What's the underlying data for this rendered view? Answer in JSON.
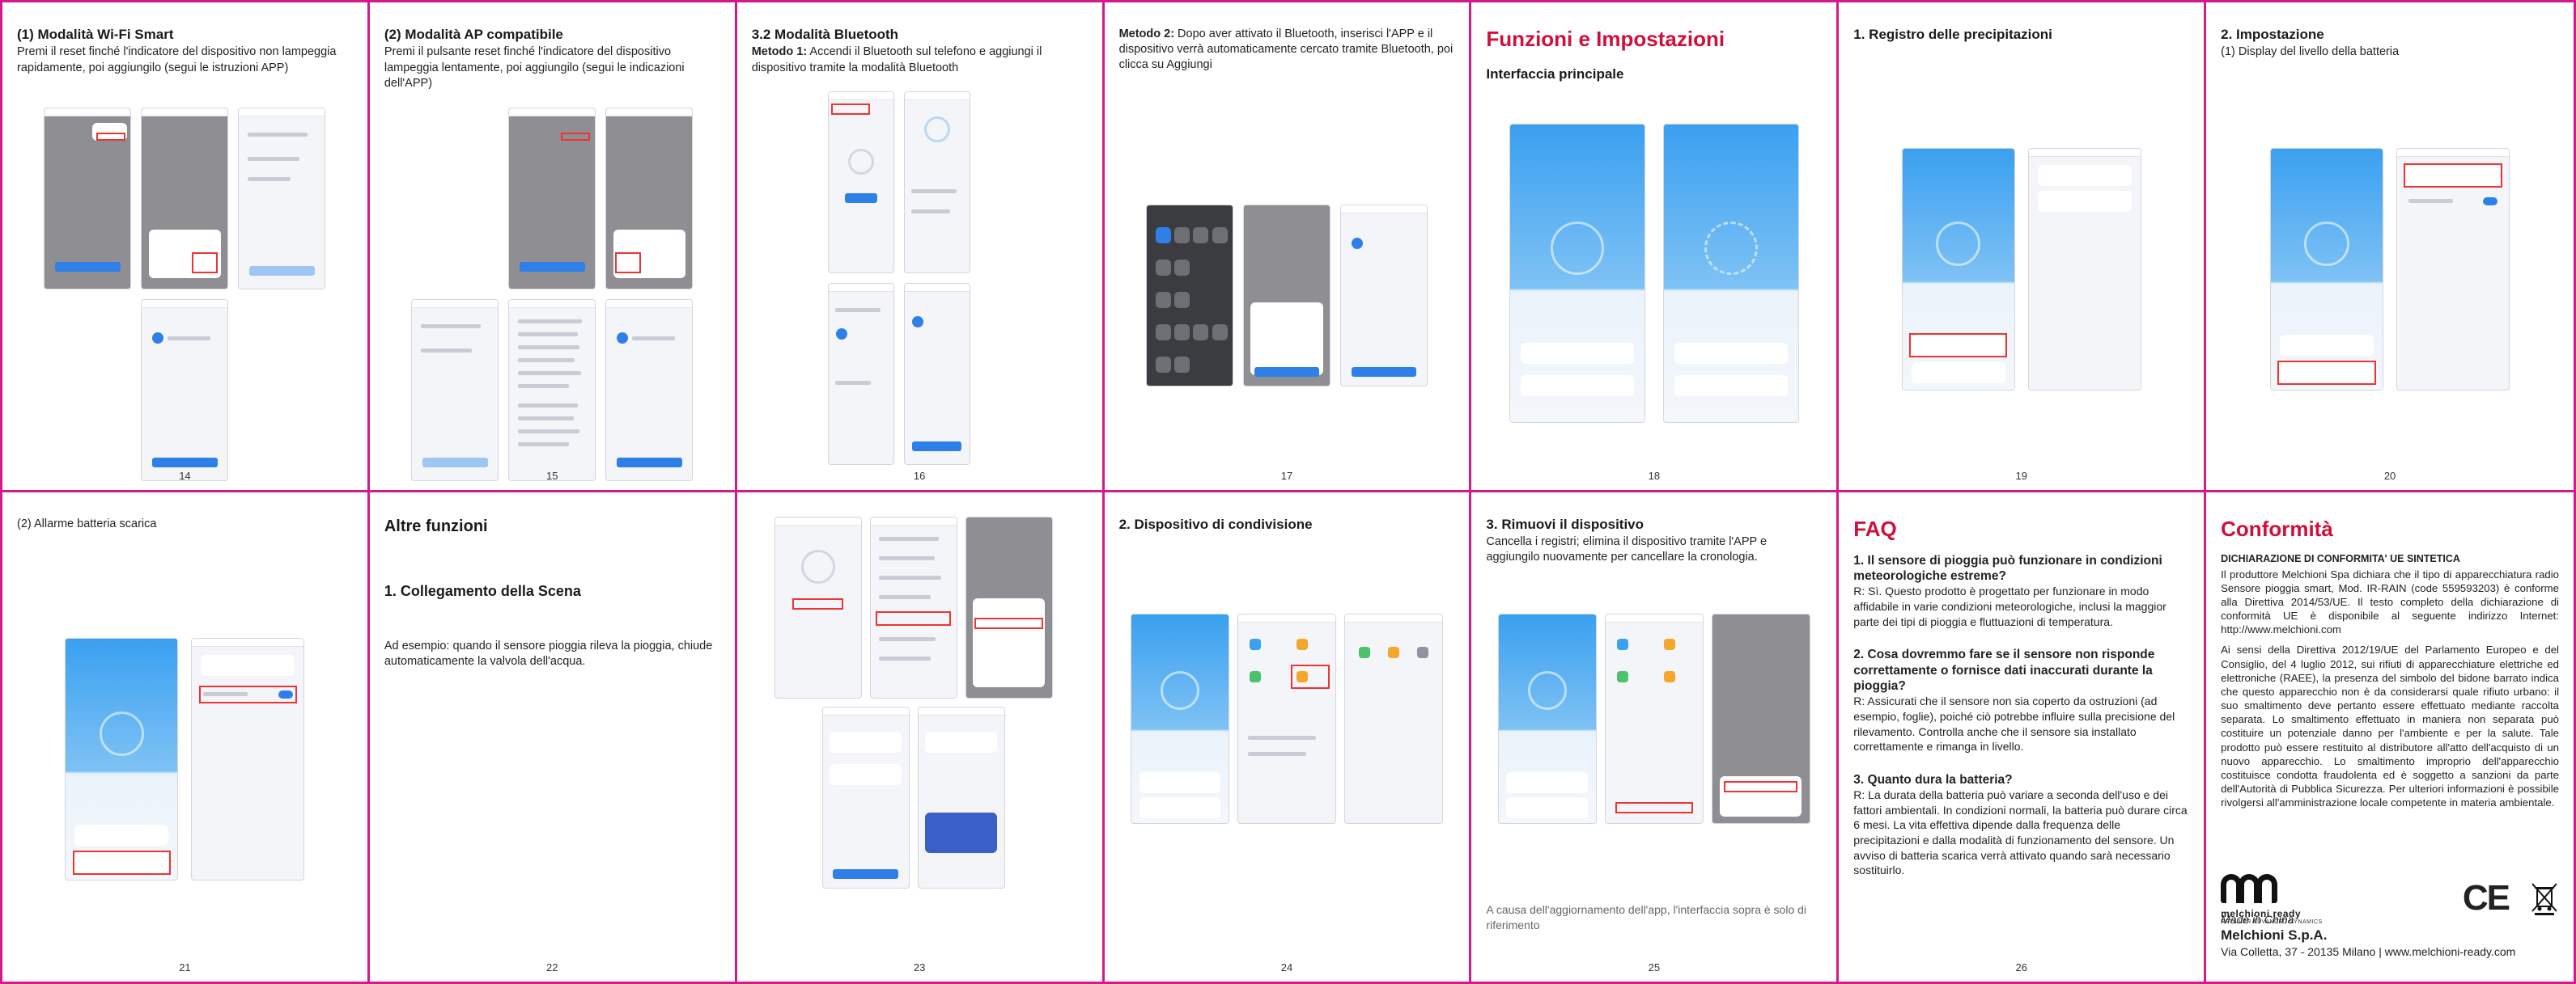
{
  "panels": {
    "p14": {
      "title": "(1) Modalità Wi-Fi Smart",
      "body": "Premi il reset finché l'indicatore del dispositivo non lampeggia rapidamente, poi aggiungilo (segui le istruzioni APP)",
      "page": "14"
    },
    "p15": {
      "title": "(2) Modalità AP compatibile",
      "body": "Premi il pulsante reset finché l'indicatore del dispositivo lampeggia lentamente, poi aggiungilo (segui le indicazioni dell'APP)",
      "page": "15"
    },
    "p16": {
      "title": "3.2 Modalità Bluetooth",
      "method": "Metodo 1:",
      "body": " Accendi il Bluetooth sul telefono e aggiungi il dispositivo tramite la modalità Bluetooth",
      "page": "16"
    },
    "p17": {
      "method": "Metodo 2:",
      "body": " Dopo aver attivato il Bluetooth, inserisci l'APP e il dispositivo verrà automaticamente cercato tramite Bluetooth, poi clicca su Aggiungi",
      "page": "17"
    },
    "p18": {
      "title": "Funzioni e Impostazioni",
      "subtitle": "Interfaccia principale",
      "page": "18"
    },
    "p19": {
      "title": "1. Registro delle precipitazioni",
      "page": "19"
    },
    "p20": {
      "title": "2. Impostazione",
      "body": "(1) Display del livello della batteria",
      "page": "20"
    },
    "p21": {
      "body": "(2) Allarme batteria scarica",
      "page": "21"
    },
    "p22": {
      "title": "Altre funzioni",
      "subtitle": "1. Collegamento della Scena",
      "body": "Ad esempio: quando il sensore pioggia rileva la pioggia, chiude automaticamente la valvola dell'acqua.",
      "page": "22"
    },
    "p23": {
      "page": "23"
    },
    "p24": {
      "title": "2. Dispositivo di condivisione",
      "page": "24"
    },
    "p25": {
      "title": "3. Rimuovi il dispositivo",
      "body": "Cancella i registri; elimina il dispositivo tramite l'APP e aggiungilo nuovamente per cancellare la cronologia.",
      "note": "A causa dell'aggiornamento dell'app, l'interfaccia sopra è solo di riferimento",
      "page": "25"
    },
    "p26": {
      "title": "FAQ",
      "q1": "1. Il sensore di pioggia può funzionare in condizioni meteorologiche estreme?",
      "a1": "R: Sì. Questo prodotto è progettato per funzionare in modo affidabile in varie condizioni meteorologiche, inclusi la maggior parte dei tipi di pioggia e fluttuazioni di temperatura.",
      "q2": "2. Cosa dovremmo fare se il sensore non risponde correttamente o fornisce dati inaccurati durante la pioggia?",
      "a2": "R: Assicurati che il sensore non sia coperto da ostruzioni (ad esempio, foglie), poiché ciò potrebbe influire sulla precisione del rilevamento. Controlla anche che il sensore sia installato correttamente e rimanga in livello.",
      "q3": "3. Quanto dura la batteria?",
      "a3": "R: La durata della batteria può variare a seconda dell'uso e dei fattori ambientali. In condizioni normali, la batteria può durare circa 6 mesi. La vita effettiva dipende dalla frequenza delle precipitazioni e dalla modalità di funzionamento del sensore. Un avviso di batteria scarica verrà attivato quando sarà necessario sostituirlo.",
      "page": "26"
    },
    "p27": {
      "title": "Conformità",
      "decl_title": "DICHIARAZIONE DI CONFORMITA' UE SINTETICA",
      "decl_body": "Il produttore Melchioni Spa dichiara che il tipo di apparecchiatura radio Sensore pioggia smart, Mod. IR-RAIN (code 559593203) è conforme alla Direttiva 2014/53/UE. Il testo completo della dichiarazione di conformità UE è disponibile al seguente indirizzo Internet: http://www.melchioni.com",
      "weee_body": "Ai sensi della Direttiva 2012/19/UE del Parlamento Europeo e del Consiglio, del 4 luglio 2012, sui rifiuti di apparecchiature elettriche ed elettroniche (RAEE), la presenza del simbolo del bidone barrato indica che questo apparecchio non è da considerarsi quale rifiuto urbano: il suo smaltimento deve pertanto essere effettuato mediante raccolta separata. Lo smaltimento effettuato in maniera non separata può costituire un potenziale danno per l'ambiente e per la salute. Tale prodotto può essere restituito al distributore all'atto dell'acquisto di un nuovo apparecchio. Lo smaltimento improprio dell'apparecchio costituisce condotta fraudolenta ed è soggetto a sanzioni da parte dell'Autorità di Pubblica Sicurezza. Per ulteriori informazioni è possibile rivolgersi all'amministrazione locale competente in materia ambientale.",
      "logo_name": "melchioni ready",
      "logo_tag": "RETAILER ADVANCED DYNAMICS",
      "ce_mark": "CE",
      "made_in": "Made in China",
      "company": "Melchioni S.p.A.",
      "address": "Via Colletta, 37 - 20135 Milano | www.melchioni-ready.com"
    }
  },
  "colors": {
    "border": "#d21a8a",
    "accent_red": "#d0103a",
    "app_blue": "#3aa0f0",
    "highlight": "#e33333"
  }
}
